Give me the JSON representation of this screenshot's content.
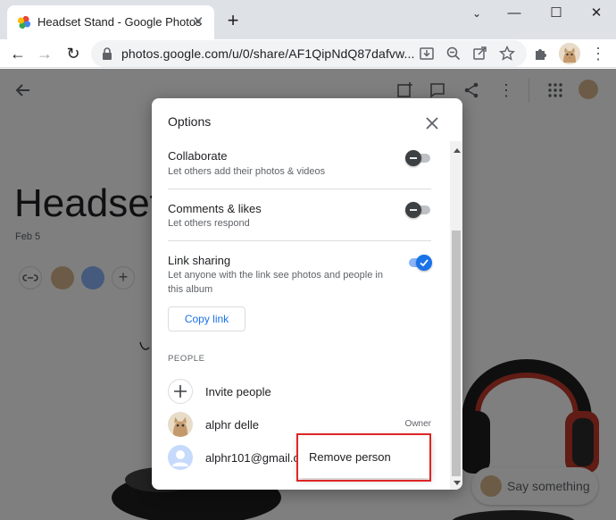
{
  "browser": {
    "tab_title": "Headset Stand - Google Photos",
    "url": "photos.google.com/u/0/share/AF1QipNdQ87dafvw..."
  },
  "page": {
    "album_title": "Headset",
    "album_date": "Feb 5",
    "chat_placeholder": "Say something"
  },
  "dialog": {
    "title": "Options",
    "options": [
      {
        "label": "Collaborate",
        "sub": "Let others add their photos & videos",
        "on": false
      },
      {
        "label": "Comments & likes",
        "sub": "Let others respond",
        "on": false
      },
      {
        "label": "Link sharing",
        "sub": "Let anyone with the link see photos and people in this album",
        "on": true
      }
    ],
    "copy_link_label": "Copy link",
    "people_heading": "PEOPLE",
    "invite_label": "Invite people",
    "people": [
      {
        "name": "alphr delle",
        "role": "Owner"
      },
      {
        "name": "alphr101@gmail.com",
        "role": ""
      }
    ]
  },
  "context_menu": {
    "remove_label": "Remove person"
  },
  "colors": {
    "accent": "#1a73e8",
    "highlight": "#e02424",
    "toggle_off": "#3c4043"
  }
}
